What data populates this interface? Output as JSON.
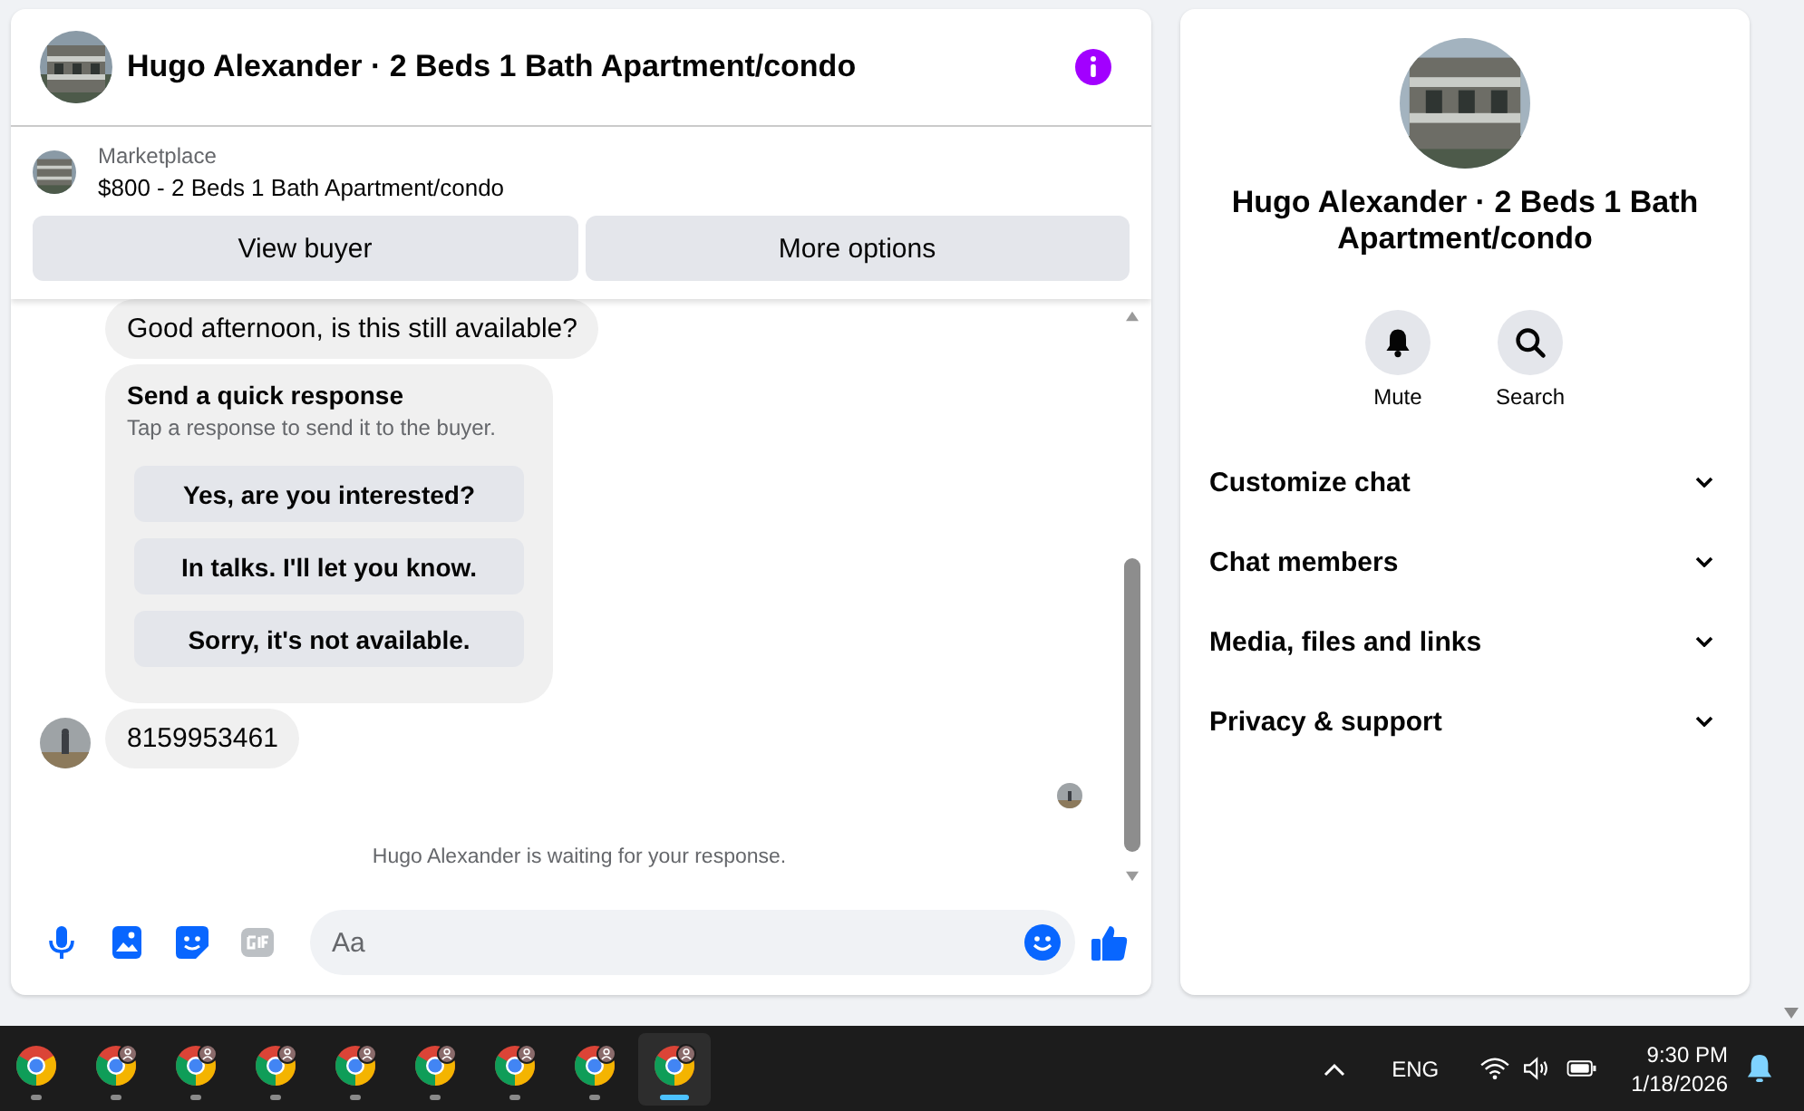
{
  "conversation": {
    "title": "Hugo Alexander · 2 Beds 1 Bath Apartment/condo"
  },
  "listing": {
    "source": "Marketplace",
    "summary": "$800 - 2 Beds 1 Bath Apartment/condo",
    "buttons": [
      "View buyer",
      "More options"
    ]
  },
  "messages": [
    {
      "kind": "text",
      "text": "Good afternoon, is this still available?",
      "avatar": false
    },
    {
      "kind": "quick_response",
      "title": "Send a quick response",
      "subtitle": "Tap a response to send it to the buyer.",
      "options": [
        "Yes, are you interested?",
        "In talks. I'll let you know.",
        "Sorry, it's not available."
      ]
    },
    {
      "kind": "text",
      "text": "8159953461",
      "avatar": true
    }
  ],
  "status": "Hugo Alexander is waiting for your response.",
  "composer": {
    "placeholder": "Aa"
  },
  "details": {
    "title": "Hugo Alexander · 2 Beds 1 Bath Apartment/condo",
    "actions": [
      {
        "kind": "mute",
        "label": "Mute"
      },
      {
        "kind": "search",
        "label": "Search"
      }
    ],
    "sections": [
      {
        "label": "Customize chat",
        "expanded": false
      },
      {
        "label": "Chat members",
        "expanded": false
      },
      {
        "label": "Media, files and links",
        "expanded": false
      },
      {
        "label": "Privacy & support",
        "expanded": false
      }
    ]
  },
  "taskbar": {
    "apps": [
      {
        "badge": false,
        "selected": false
      },
      {
        "badge": true,
        "selected": false
      },
      {
        "badge": true,
        "selected": false
      },
      {
        "badge": true,
        "selected": false
      },
      {
        "badge": true,
        "selected": false
      },
      {
        "badge": true,
        "selected": false
      },
      {
        "badge": true,
        "selected": false
      },
      {
        "badge": true,
        "selected": false
      },
      {
        "badge": true,
        "selected": true
      }
    ],
    "language": "ENG",
    "time": "9:30 PM",
    "date": "1/18/2026"
  }
}
